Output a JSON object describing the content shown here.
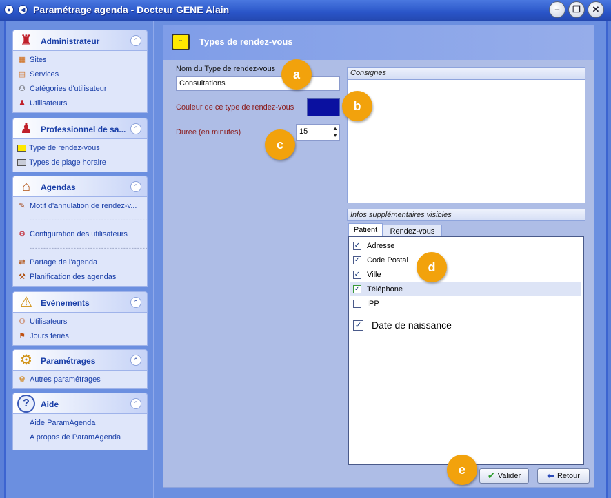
{
  "window": {
    "title": "Paramétrage agenda - Docteur GENE Alain"
  },
  "sidebar": {
    "groups": [
      {
        "title": "Administrateur",
        "items": [
          "Sites",
          "Services",
          "Catégories d'utilisateur",
          "Utilisateurs"
        ]
      },
      {
        "title": "Professionnel de sa...",
        "items": [
          "Type de rendez-vous",
          "Types de plage horaire"
        ]
      },
      {
        "title": "Agendas",
        "items": [
          "Motif d'annulation de rendez-v...",
          "Configuration des utilisateurs",
          "Partage de l'agenda",
          "Planification des agendas"
        ]
      },
      {
        "title": "Evènements",
        "items": [
          "Utilisateurs",
          "Jours fériés"
        ]
      },
      {
        "title": "Paramétrages",
        "items": [
          "Autres paramétrages"
        ]
      },
      {
        "title": "Aide",
        "items": [
          "Aide ParamAgenda",
          "A propos de ParamAgenda"
        ]
      }
    ],
    "separator": "-----------------------------------------------"
  },
  "main": {
    "title": "Types de rendez-vous",
    "name_label": "Nom du Type de rendez-vous",
    "name_value": "Consultations",
    "color_label": "Couleur de ce type de rendez-vous",
    "duration_label": "Durée (en minutes)",
    "duration_value": "15",
    "consignes_title": "Consignes",
    "infos_title": "Infos supplémentaires visibles",
    "tabs": [
      "Patient",
      "Rendez-vous"
    ],
    "checkboxes": [
      {
        "label": "Adresse",
        "checked": true
      },
      {
        "label": "Code Postal",
        "checked": true
      },
      {
        "label": "Ville",
        "checked": true
      },
      {
        "label": "Téléphone",
        "checked": true
      },
      {
        "label": "IPP",
        "checked": false
      }
    ],
    "extra_checkbox": {
      "label": "Date de naissance",
      "checked": true
    },
    "buttons": {
      "validate": "Valider",
      "back": "Retour"
    }
  },
  "annotations": [
    "a",
    "b",
    "c",
    "d",
    "e"
  ],
  "colors": {
    "rdv_color": "#0a10a0",
    "badge": "#f2a20c",
    "title_blue": "#1a3fa8"
  }
}
